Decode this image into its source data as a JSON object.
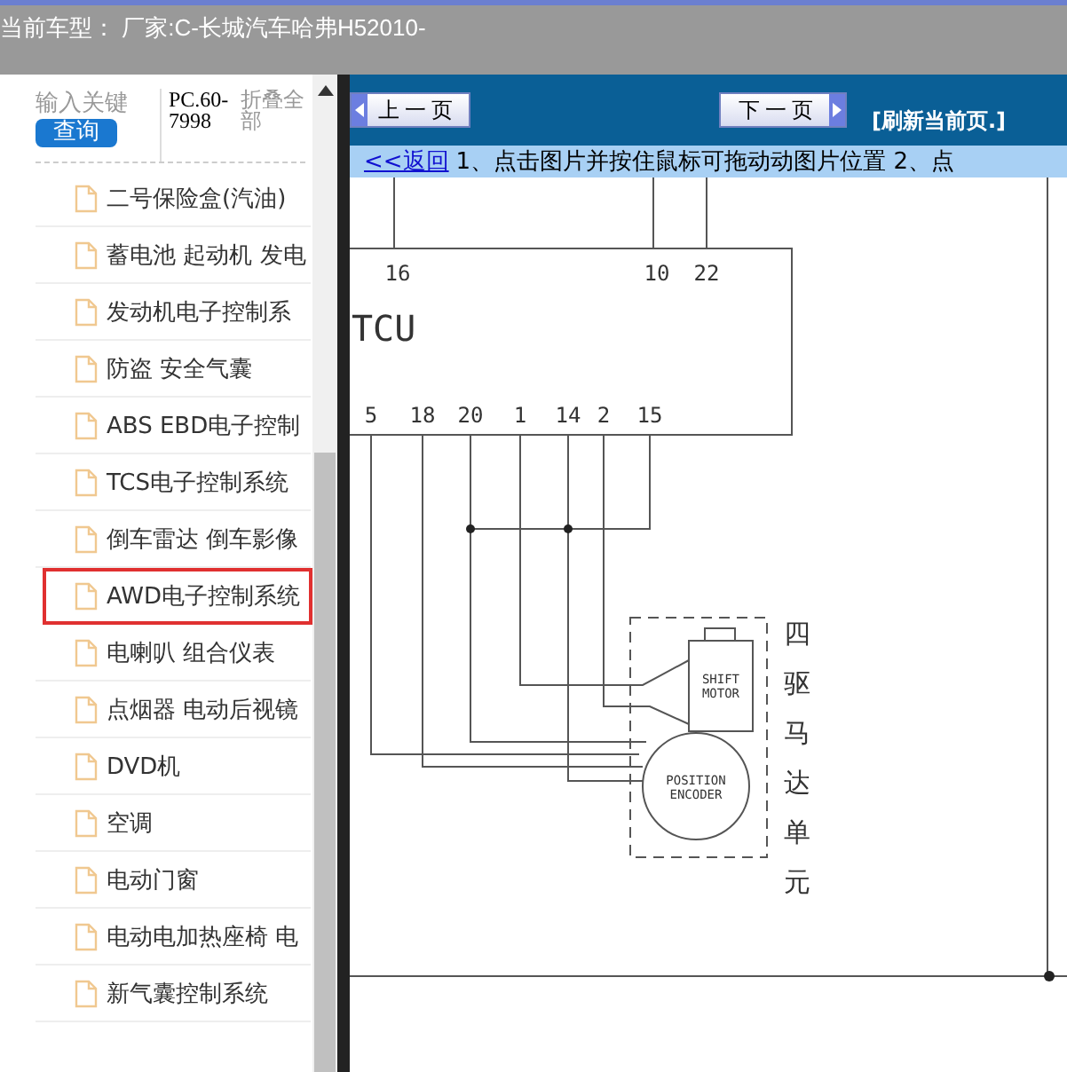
{
  "header": {
    "title": "当前车型： 厂家:C-长城汽车哈弗H52010-"
  },
  "sidebar": {
    "search": {
      "placeholder": "输入关键",
      "button": "查询"
    },
    "code": "PC.60-7998",
    "collapse": "折叠全部",
    "items": [
      {
        "label": "二号保险盒(汽油)",
        "selected": false
      },
      {
        "label": "蓄电池 起动机 发电",
        "selected": false
      },
      {
        "label": "发动机电子控制系",
        "selected": false
      },
      {
        "label": "防盗 安全气囊",
        "selected": false
      },
      {
        "label": "ABS EBD电子控制",
        "selected": false
      },
      {
        "label": "TCS电子控制系统",
        "selected": false
      },
      {
        "label": "倒车雷达 倒车影像",
        "selected": false
      },
      {
        "label": "AWD电子控制系统",
        "selected": true
      },
      {
        "label": "电喇叭 组合仪表",
        "selected": false
      },
      {
        "label": "点烟器 电动后视镜",
        "selected": false
      },
      {
        "label": "DVD机",
        "selected": false
      },
      {
        "label": "空调",
        "selected": false
      },
      {
        "label": "电动门窗",
        "selected": false
      },
      {
        "label": "电动电加热座椅 电",
        "selected": false
      },
      {
        "label": "新气囊控制系统",
        "selected": false
      }
    ]
  },
  "toolbar": {
    "prev": "上一页",
    "next": "下一页",
    "refresh": "[刷新当前页.]"
  },
  "hint_bar": {
    "back_link": "<<返回",
    "text": "1、点击图片并按住鼠标可拖动动图片位置 2、点"
  },
  "diagram": {
    "unit": "TCU",
    "top_pins": [
      "16",
      "10",
      "22"
    ],
    "bottom_pins": [
      "5",
      "18",
      "20",
      "1",
      "14",
      "2",
      "15"
    ],
    "motor_label": [
      "SHIFT",
      "MOTOR"
    ],
    "encoder_label": [
      "POSITION",
      "ENCODER"
    ],
    "side_label": "四驱马达单元"
  }
}
